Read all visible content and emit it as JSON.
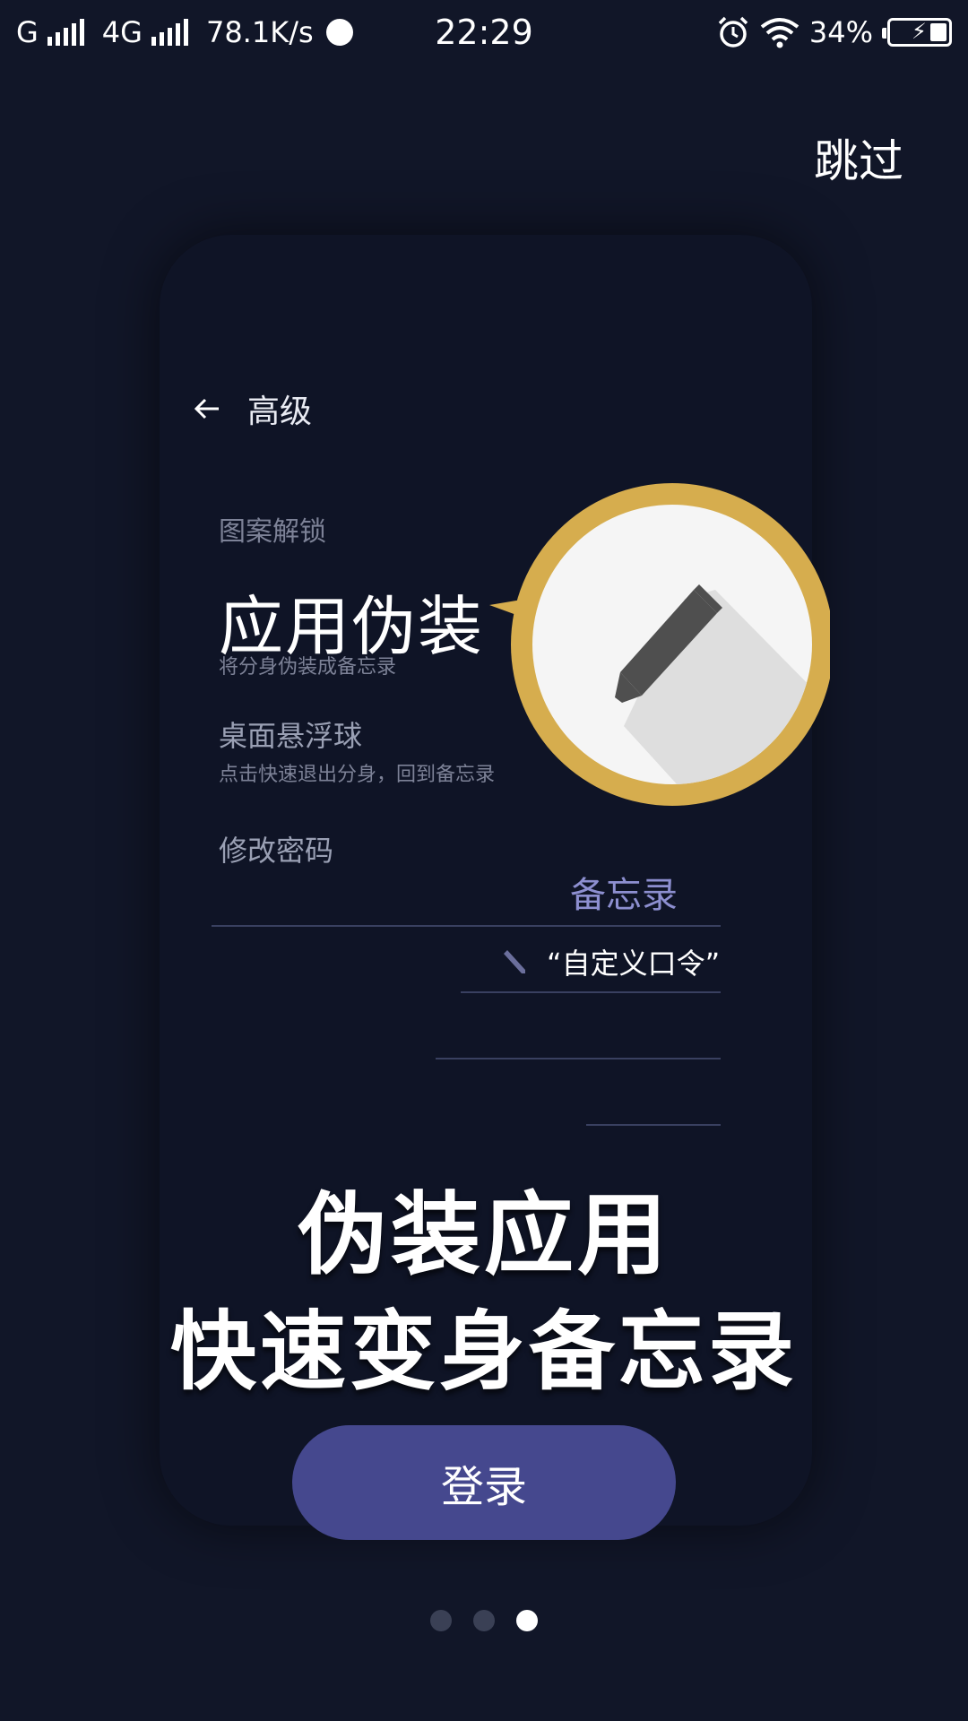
{
  "status_bar": {
    "carrier1": "G",
    "carrier2": "4G",
    "speed": "78.1K/s",
    "time": "22:29",
    "battery_percent": "34%",
    "icons": [
      "signal-icon",
      "signal-icon",
      "moon-icon",
      "alarm-icon",
      "wifi-icon",
      "battery-charging-icon"
    ]
  },
  "header": {
    "skip_label": "跳过"
  },
  "mockup": {
    "back_icon": "arrow-left-icon",
    "title": "高级",
    "items": {
      "pattern_lock": "图案解锁",
      "disguise_title": "应用伪装",
      "disguise_sub": "将分身伪装成备忘录",
      "float_ball_title": "桌面悬浮球",
      "float_ball_sub": "点击快速退出分身，回到备忘录",
      "change_password": "修改密码"
    },
    "memo_label": "备忘录",
    "custom_command": "“自定义口令”",
    "bubble_icon": "pencil-icon"
  },
  "headline": {
    "line1": "伪装应用",
    "line2": "快速变身备忘录"
  },
  "login_label": "登录",
  "pager": {
    "count": 3,
    "active_index": 2
  },
  "colors": {
    "background": "#111628",
    "button": "#45488e",
    "bubble_ring": "#d6ad4e",
    "memo_text": "#8d8fd0"
  }
}
